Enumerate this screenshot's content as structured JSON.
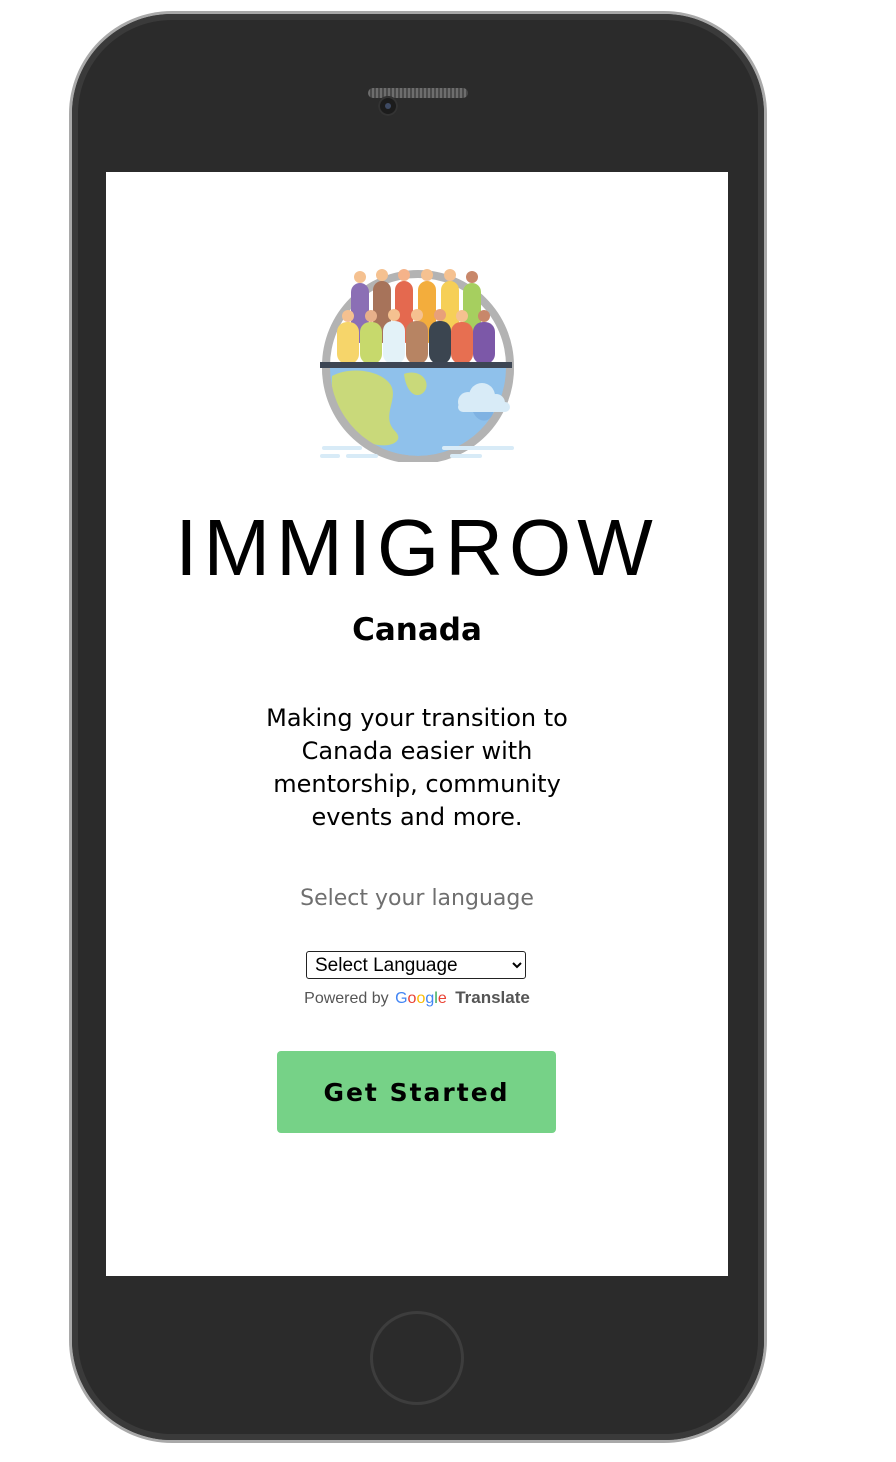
{
  "app": {
    "title": "IMMIGROW",
    "subtitle": "Canada",
    "tagline": "Making your transition to Canada easier with mentorship, community events and more."
  },
  "language": {
    "label": "Select your language",
    "selected": "Select Language",
    "powered_by": "Powered by",
    "google_letters": [
      "G",
      "o",
      "o",
      "g",
      "l",
      "e"
    ],
    "translate": "Translate"
  },
  "cta": {
    "label": "Get Started",
    "color": "#76d287"
  },
  "icons": {
    "logo": "globe-people-logo-icon",
    "select_arrow": "chevron-down-icon"
  }
}
